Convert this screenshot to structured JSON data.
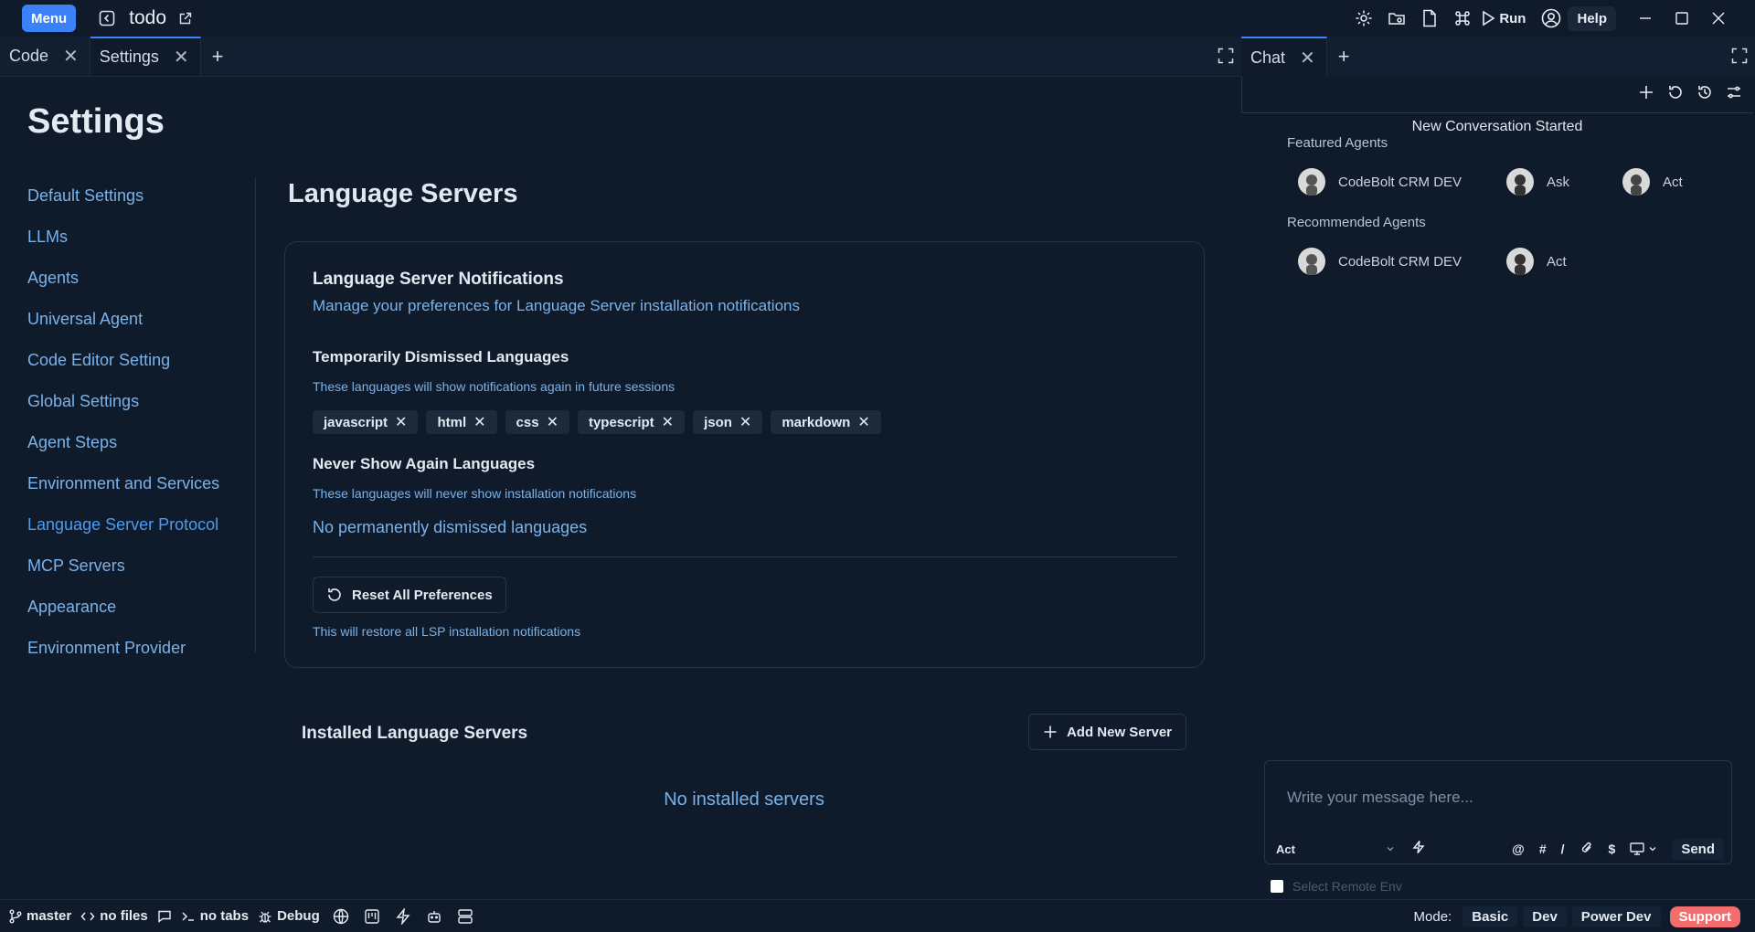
{
  "titlebar": {
    "menu_label": "Menu",
    "project_name": "todo",
    "run_label": "Run",
    "help_label": "Help"
  },
  "tabs": [
    {
      "label": "Code"
    },
    {
      "label": "Settings"
    }
  ],
  "chat_tab": {
    "label": "Chat"
  },
  "settings": {
    "title": "Settings",
    "nav": [
      {
        "label": "Default Settings"
      },
      {
        "label": "LLMs"
      },
      {
        "label": "Agents"
      },
      {
        "label": "Universal Agent"
      },
      {
        "label": "Code Editor Setting"
      },
      {
        "label": "Global Settings"
      },
      {
        "label": "Agent Steps"
      },
      {
        "label": "Environment and Services"
      },
      {
        "label": "Language Server Protocol"
      },
      {
        "label": "MCP Servers"
      },
      {
        "label": "Appearance"
      },
      {
        "label": "Environment Provider"
      }
    ],
    "active_nav": "Language Server Protocol"
  },
  "lsp": {
    "title": "Language Servers",
    "notifications": {
      "heading": "Language Server Notifications",
      "description": "Manage your preferences for Language Server installation notifications",
      "temp_heading": "Temporarily Dismissed Languages",
      "temp_hint": "These languages will show notifications again in future sessions",
      "temp_languages": [
        "javascript",
        "html",
        "css",
        "typescript",
        "json",
        "markdown"
      ],
      "never_heading": "Never Show Again Languages",
      "never_hint": "These languages will never show installation notifications",
      "never_empty": "No permanently dismissed languages",
      "reset_label": "Reset All Preferences",
      "reset_hint": "This will restore all LSP installation notifications"
    },
    "installed": {
      "heading": "Installed Language Servers",
      "add_label": "Add New Server",
      "empty": "No installed servers"
    }
  },
  "chat": {
    "conversation_status": "New Conversation Started",
    "featured_label": "Featured Agents",
    "featured": [
      {
        "name": "CodeBolt CRM DEV"
      },
      {
        "name": "Ask"
      },
      {
        "name": "Act"
      }
    ],
    "recommended_label": "Recommended Agents",
    "recommended": [
      {
        "name": "CodeBolt CRM DEV"
      },
      {
        "name": "Act"
      }
    ],
    "composer": {
      "placeholder": "Write your message here...",
      "mode": "Act",
      "tools": [
        "@",
        "#",
        "/",
        "$"
      ],
      "send_label": "Send"
    },
    "remote_env_label": "Select Remote Env"
  },
  "statusbar": {
    "branch": "master",
    "files": "no files",
    "tabs": "no tabs",
    "debug": "Debug",
    "mode_label": "Mode:",
    "modes": [
      "Basic",
      "Dev",
      "Power Dev"
    ],
    "support_label": "Support"
  },
  "colors": {
    "background": "#0f1b2b",
    "accent": "#3b82f6",
    "link": "#7ab2ea",
    "support": "#f26d6d"
  }
}
